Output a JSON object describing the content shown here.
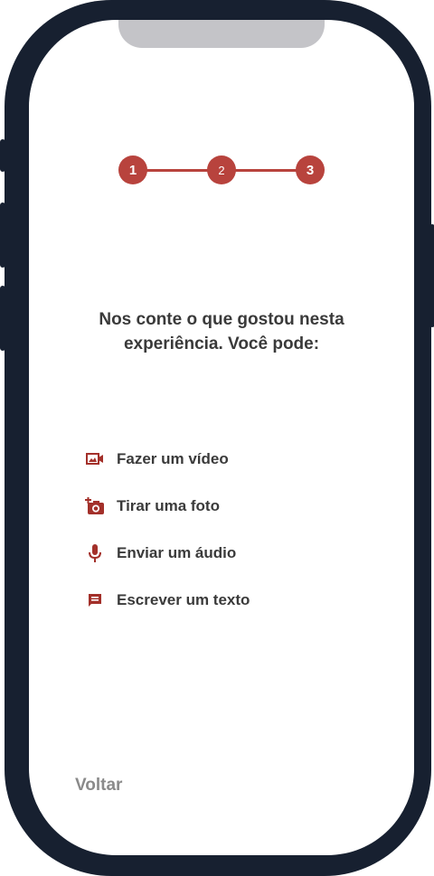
{
  "stepper": {
    "steps": [
      "1",
      "2",
      "3"
    ],
    "color": "#b8433d"
  },
  "heading": "Nos conte o que gostou nesta experiência. Você pode:",
  "options": [
    {
      "label": "Fazer um vídeo",
      "icon": "video-icon"
    },
    {
      "label": "Tirar uma foto",
      "icon": "camera-add-icon"
    },
    {
      "label": "Enviar um áudio",
      "icon": "microphone-icon"
    },
    {
      "label": "Escrever um texto",
      "icon": "message-icon"
    }
  ],
  "back_label": "Voltar",
  "colors": {
    "frame": "#172030",
    "accent": "#b8433d",
    "text": "#3a3a3a",
    "muted": "#8a8a8a"
  }
}
